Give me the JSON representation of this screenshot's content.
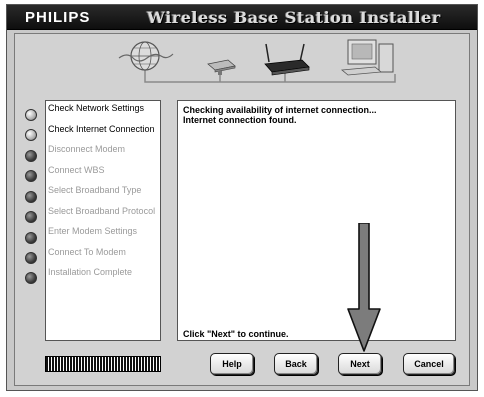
{
  "window": {
    "brand": "PHILIPS",
    "title": "Wireless Base Station Installer"
  },
  "steps": [
    {
      "label": "Check Network Settings",
      "status": "done"
    },
    {
      "label": "Check Internet Connection",
      "status": "done"
    },
    {
      "label": "Disconnect Modem",
      "status": "pending"
    },
    {
      "label": "Connect WBS",
      "status": "pending"
    },
    {
      "label": "Select Broadband Type",
      "status": "pending"
    },
    {
      "label": "Select Broadband Protocol",
      "status": "pending"
    },
    {
      "label": "Enter Modem Settings",
      "status": "pending"
    },
    {
      "label": "Connect To Modem",
      "status": "pending"
    },
    {
      "label": "Installation Complete",
      "status": "pending"
    }
  ],
  "log": {
    "lines": [
      "Checking availability of internet connection...",
      "Internet connection found."
    ],
    "footer": "Click \"Next\" to continue."
  },
  "buttons": {
    "help": "Help",
    "back": "Back",
    "next": "Next",
    "cancel": "Cancel"
  },
  "icons": [
    "globe-icon",
    "modem-icon",
    "router-icon",
    "computer-icon"
  ],
  "colors": {
    "titlebar": "#111111",
    "background": "#d2d2d2",
    "step_done_text": "#000000",
    "step_pending_text": "#9a9a9a"
  }
}
